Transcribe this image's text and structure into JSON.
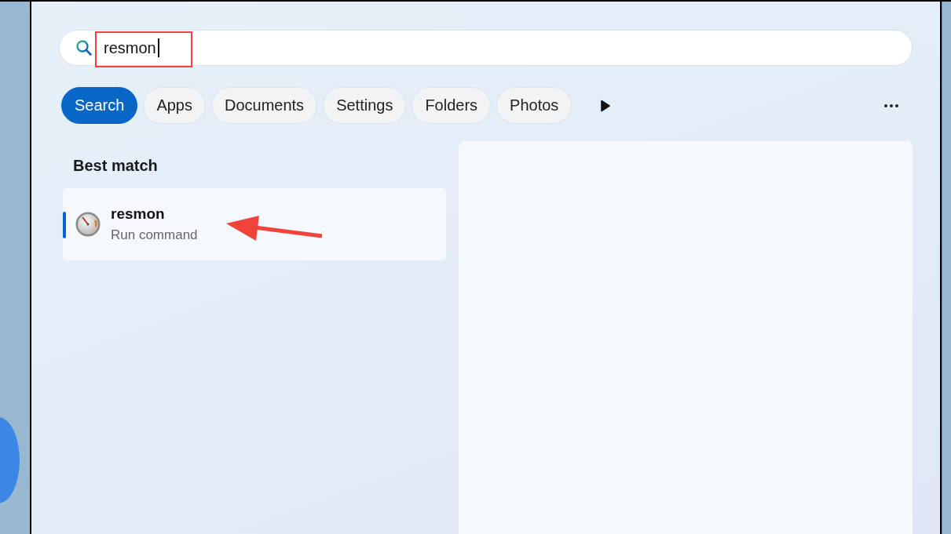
{
  "search": {
    "value": "resmon"
  },
  "filters": [
    {
      "label": "Search",
      "selected": true
    },
    {
      "label": "Apps",
      "selected": false
    },
    {
      "label": "Documents",
      "selected": false
    },
    {
      "label": "Settings",
      "selected": false
    },
    {
      "label": "Folders",
      "selected": false
    },
    {
      "label": "Photos",
      "selected": false
    }
  ],
  "results": {
    "heading": "Best match",
    "items": [
      {
        "title": "resmon",
        "subtitle": "Run command",
        "selected": true
      }
    ]
  },
  "annotations": {
    "highlight_box": true,
    "arrow": true
  }
}
